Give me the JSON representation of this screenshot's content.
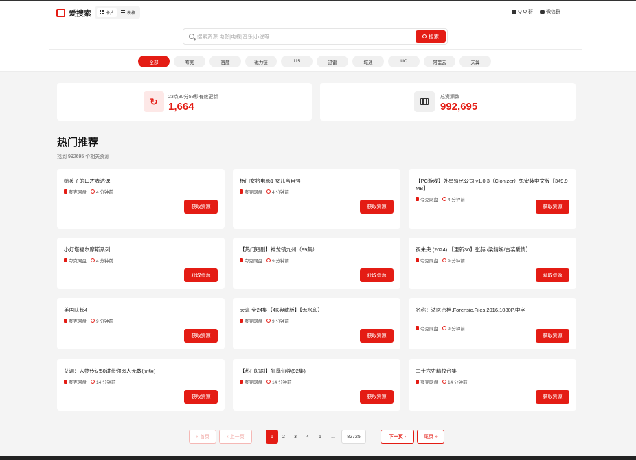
{
  "header": {
    "logo_text": "爱搜索",
    "view_toggle": [
      {
        "label": "卡片",
        "icon": "grid-icon",
        "active": true
      },
      {
        "label": "表格",
        "icon": "list-icon",
        "active": false
      }
    ],
    "groups": [
      {
        "label": "Q Q 群",
        "icon": "qq-icon"
      },
      {
        "label": "微信群",
        "icon": "wechat-icon"
      }
    ]
  },
  "search": {
    "placeholder": "搜索资源:电影|电视|音乐|小说等",
    "value": "",
    "button_label": "搜索"
  },
  "categories": [
    {
      "label": "全部",
      "active": true
    },
    {
      "label": "夸克"
    },
    {
      "label": "百度"
    },
    {
      "label": "磁力链"
    },
    {
      "label": "115"
    },
    {
      "label": "迅雷"
    },
    {
      "label": "城通"
    },
    {
      "label": "UC"
    },
    {
      "label": "阿里云"
    },
    {
      "label": "天翼"
    }
  ],
  "stats": [
    {
      "label": "23点30分58秒有效更新",
      "value": "1,664",
      "icon": "refresh-icon"
    },
    {
      "label": "总资源数",
      "value": "992,695",
      "icon": "film-icon"
    }
  ],
  "section": {
    "title": "热门推荐",
    "subtitle": "找到 992695 个相关资源"
  },
  "cards": [
    {
      "title": "给孩子的口才表达课",
      "source": "夸克网盘",
      "time": "4 分钟前"
    },
    {
      "title": "杨门女将电影1 女儿当自强",
      "source": "夸克网盘",
      "time": "4 分钟前"
    },
    {
      "title": "【PC游戏】外星殖民公司 v1.0.3（Clonizer）免安装中文版【349.9 MB】",
      "source": "夸克网盘",
      "time": "4 分钟前"
    },
    {
      "title": "小灯塔福尔摩斯系列",
      "source": "夸克网盘",
      "time": "4 分钟前"
    },
    {
      "title": "【热门短剧】神龙镇九州（99集）",
      "source": "夸克网盘",
      "time": "9 分钟前"
    },
    {
      "title": "夜未央 (2024) 【更新30】张赫 /梁婧娴/古装爱情】",
      "source": "夸克网盘",
      "time": "9 分钟前"
    },
    {
      "title": "美国队长4",
      "source": "夸克网盘",
      "time": "9 分钟前"
    },
    {
      "title": "天道 全24集【4K典藏版】【无水印】",
      "source": "夸克网盘",
      "time": "9 分钟前"
    },
    {
      "title": "名称：法医密档.Forensic.Files.2016.1080P.中字",
      "source": "夸克网盘",
      "time": "9 分钟前"
    },
    {
      "title": "艾迦：人物传记50讲带你阅人无数(完结)",
      "source": "夸克网盘",
      "time": "14 分钟前"
    },
    {
      "title": "【热门短剧】狂暴仙尊(92集)",
      "source": "夸克网盘",
      "time": "14 分钟前"
    },
    {
      "title": "二十六史精校合集",
      "source": "夸克网盘",
      "time": "14 分钟前"
    }
  ],
  "card_button_label": "获取资源",
  "pagination": {
    "first": "« 首页",
    "prev": "‹ 上一页",
    "pages": [
      "1",
      "2",
      "3",
      "4",
      "5"
    ],
    "current": "1",
    "ellipsis": "...",
    "last_page": "82725",
    "next": "下一页 ›",
    "end": "尾页 »"
  },
  "colors": {
    "accent": "#e41c14"
  }
}
